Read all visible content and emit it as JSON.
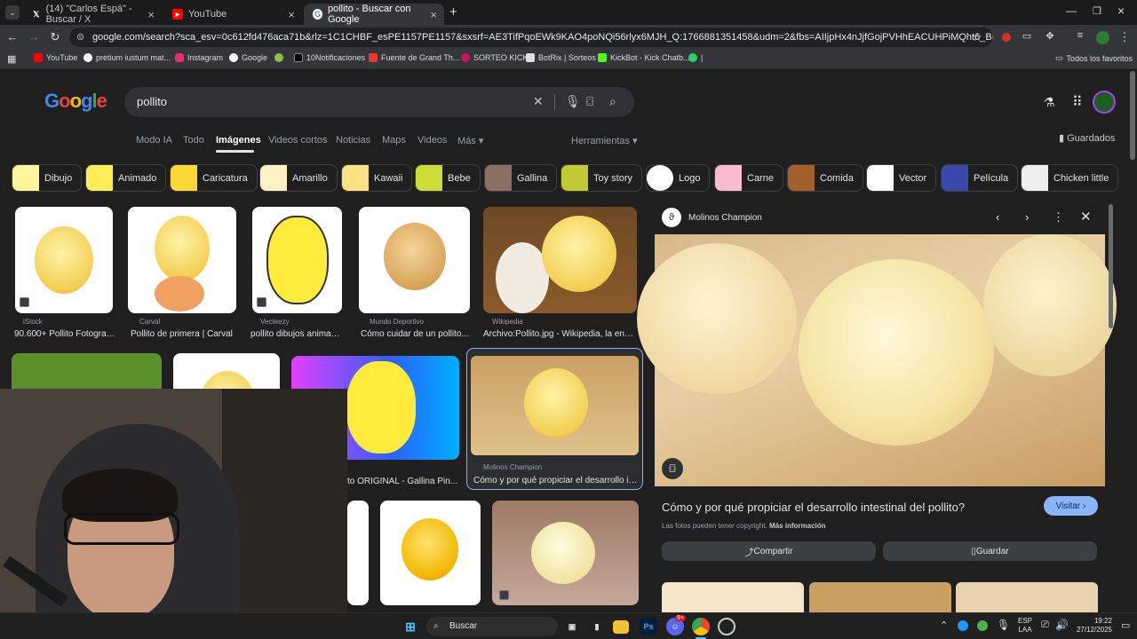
{
  "browser": {
    "tabs": [
      {
        "title": "(14) \"Carlos Espá\" - Buscar / X",
        "icon": "x-icon"
      },
      {
        "title": "YouTube",
        "icon": "youtube-icon"
      },
      {
        "title": "pollito - Buscar con Google",
        "icon": "google-icon",
        "active": true
      }
    ],
    "new_tab": "+",
    "url": "google.com/search?sca_esv=0c612fd476aca71b&rlz=1C1CHBF_esPE1157PE1157&sxsrf=AE3TifPqoEWk9KAO4poNQi56rlyx6MJH_Q:1766881351458&udm=2&fbs=AIIjpHx4nJjfGojPVHhEACUHPiMQht6_BFq6vBIoFFRK7qchKEOG9SkJ7ODu_...",
    "bookmarks": [
      "YouTube",
      "pretium iustum mat...",
      "Instagram",
      "Google",
      "",
      "10Notificaciones",
      "Fuente de Grand Th...",
      "SORTEO KICK",
      "BotRix | Sorteos",
      "KickBot - Kick Chatb...",
      "|"
    ],
    "all_favorites": "Todos los favoritos"
  },
  "google": {
    "logo": "Google",
    "query": "pollito",
    "tabs": [
      "Modo IA",
      "Todo",
      "Imágenes",
      "Videos cortos",
      "Noticias",
      "Maps",
      "Videos",
      "Más ▾"
    ],
    "selected_tab": "Imágenes",
    "tools": "Herramientas ▾",
    "saved": "Guardados",
    "chips": [
      "Dibujo",
      "Animado",
      "Caricatura",
      "Amarillo",
      "Kawaii",
      "Bebe",
      "Gallina",
      "Toy story",
      "Logo",
      "Carne",
      "Comida",
      "Vector",
      "Película",
      "Chicken little"
    ],
    "results": [
      {
        "source": "iStock",
        "caption": "90.600+ Pollito Fotograf..."
      },
      {
        "source": "Carval",
        "caption": "Pollito de primera | Carval"
      },
      {
        "source": "Vecteezy",
        "caption": "pollito dibujos animad..."
      },
      {
        "source": "Mundo Deportivo",
        "caption": "Cómo cuidar de un pollito..."
      },
      {
        "source": "Wikipedia",
        "caption": "Archivo:Pollito.jpg - Wikipedia, la enci..."
      },
      {
        "source": "",
        "caption": "to ORIGINAL - Gallina Pin..."
      },
      {
        "source": "Molinos Champion",
        "caption": "Cómo y por qué propiciar el desarrollo in..."
      }
    ]
  },
  "panel": {
    "source": "Molinos Champion",
    "title": "Cómo y por qué propiciar el desarrollo intestinal del pollito?",
    "visit": "Visitar ›",
    "copyright": "Las fotos pueden tener copyright.",
    "more_info": "Más información",
    "share": "Compartir",
    "save": "Guardar"
  },
  "taskbar": {
    "search": "Buscar",
    "lang1": "ESP",
    "lang2": "LAA",
    "time": "19:22",
    "date": "27/12/2025",
    "discord_badge": "9+"
  }
}
